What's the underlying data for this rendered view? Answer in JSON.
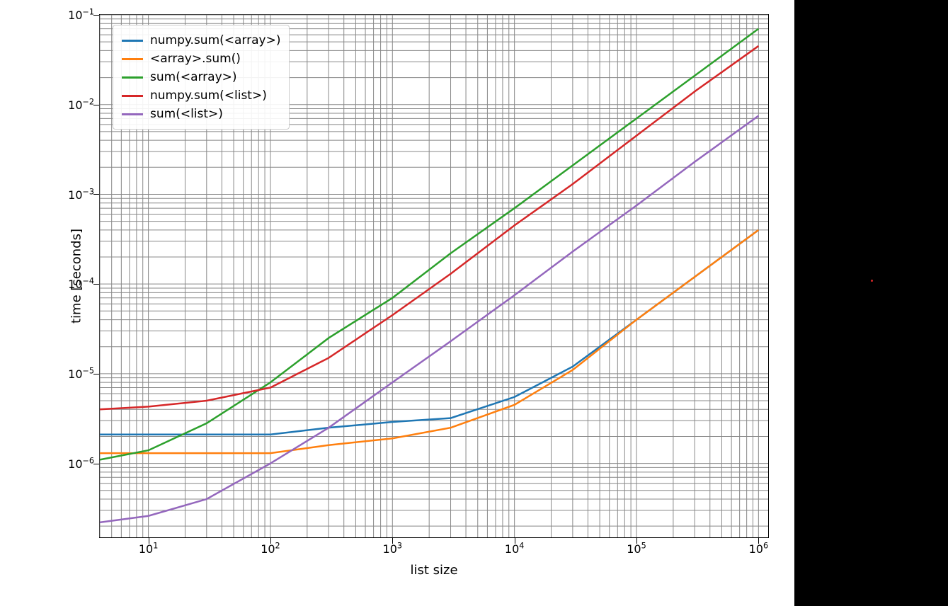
{
  "chart_data": {
    "type": "line",
    "title": "",
    "xlabel": "list size",
    "ylabel": "time [seconds]",
    "xscale": "log",
    "yscale": "log",
    "xlim": [
      4,
      1200000
    ],
    "ylim": [
      1.5e-07,
      0.1
    ],
    "x_ticks": [
      10,
      100,
      1000,
      10000,
      100000,
      1000000
    ],
    "x_tick_labels": [
      "10¹",
      "10²",
      "10³",
      "10⁴",
      "10⁵",
      "10⁶"
    ],
    "y_ticks": [
      1e-06,
      1e-05,
      0.0001,
      0.001,
      0.01,
      0.1
    ],
    "y_tick_labels": [
      "10⁻⁶",
      "10⁻⁵",
      "10⁻⁴",
      "10⁻³",
      "10⁻²",
      "10⁻¹"
    ],
    "x": [
      4,
      10,
      30,
      100,
      300,
      1000,
      3000,
      10000,
      30000,
      100000,
      300000,
      1000000
    ],
    "series": [
      {
        "name": "numpy.sum(<array>)",
        "color": "#1f77b4",
        "values": [
          2.1e-06,
          2.1e-06,
          2.1e-06,
          2.1e-06,
          2.5e-06,
          2.9e-06,
          3.2e-06,
          5.5e-06,
          1.2e-05,
          4e-05,
          0.00012,
          0.0004
        ]
      },
      {
        "name": "<array>.sum()",
        "color": "#ff7f0e",
        "values": [
          1.3e-06,
          1.3e-06,
          1.3e-06,
          1.3e-06,
          1.6e-06,
          1.9e-06,
          2.5e-06,
          4.5e-06,
          1.1e-05,
          4e-05,
          0.00012,
          0.0004
        ]
      },
      {
        "name": "sum(<array>)",
        "color": "#2ca02c",
        "values": [
          1.1e-06,
          1.4e-06,
          2.8e-06,
          8e-06,
          2.5e-05,
          7e-05,
          0.00022,
          0.0007,
          0.0021,
          0.007,
          0.021,
          0.07
        ]
      },
      {
        "name": "numpy.sum(<list>)",
        "color": "#d62728",
        "values": [
          4e-06,
          4.3e-06,
          5e-06,
          7e-06,
          1.5e-05,
          4.5e-05,
          0.00013,
          0.00045,
          0.0013,
          0.0045,
          0.014,
          0.045
        ]
      },
      {
        "name": "sum(<list>)",
        "color": "#9467bd",
        "values": [
          2.2e-07,
          2.6e-07,
          4e-07,
          1e-06,
          2.5e-06,
          8e-06,
          2.3e-05,
          7.5e-05,
          0.00023,
          0.00075,
          0.0023,
          0.0075
        ]
      }
    ],
    "grid": true,
    "legend_position": "upper left"
  }
}
